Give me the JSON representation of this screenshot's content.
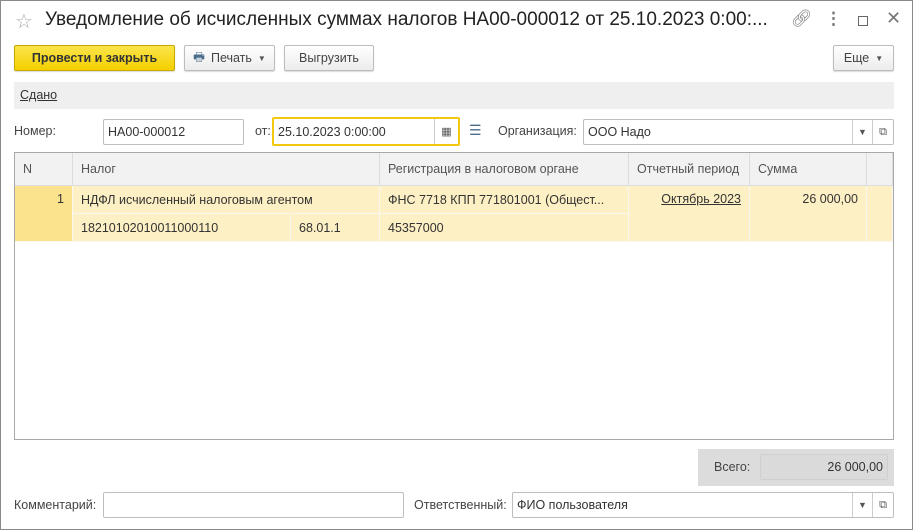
{
  "window": {
    "title": "Уведомление об исчисленных суммах налогов НА00-000012 от 25.10.2023 0:00:...",
    "icons": [
      "star-icon",
      "link-icon",
      "more-icon",
      "maximize-icon",
      "close-icon"
    ]
  },
  "toolbar": {
    "post_close": "Провести и закрыть",
    "print": "Печать",
    "export": "Выгрузить",
    "more": "Еще"
  },
  "status": {
    "link": "Сдано"
  },
  "header": {
    "number_label": "Номер:",
    "number_value": "НА00-000012",
    "date_label": "от:",
    "date_value": "25.10.2023  0:00:00",
    "org_label": "Организация:",
    "org_value": "ООО Надо"
  },
  "table": {
    "columns": [
      "N",
      "Налог",
      "Регистрация в налоговом органе",
      "Отчетный период",
      "Сумма"
    ],
    "rows": [
      {
        "n": "1",
        "tax": "НДФЛ исчисленный налоговым агентом",
        "kbk": "18210102010011000110",
        "account": "68.01.1",
        "registration": "ФНС 7718 КПП 771801001 (Общест...",
        "oktmo": "45357000",
        "period": "Октябрь 2023",
        "sum": "26 000,00"
      }
    ]
  },
  "totals": {
    "label": "Всего:",
    "value": "26 000,00"
  },
  "footer": {
    "comment_label": "Комментарий:",
    "comment_value": "",
    "responsible_label": "Ответственный:",
    "responsible_value": "ФИО пользователя"
  },
  "colors": {
    "accent": "#f4d000",
    "selected_row": "#fdf0c4",
    "row_marker": "#fbe38e"
  }
}
